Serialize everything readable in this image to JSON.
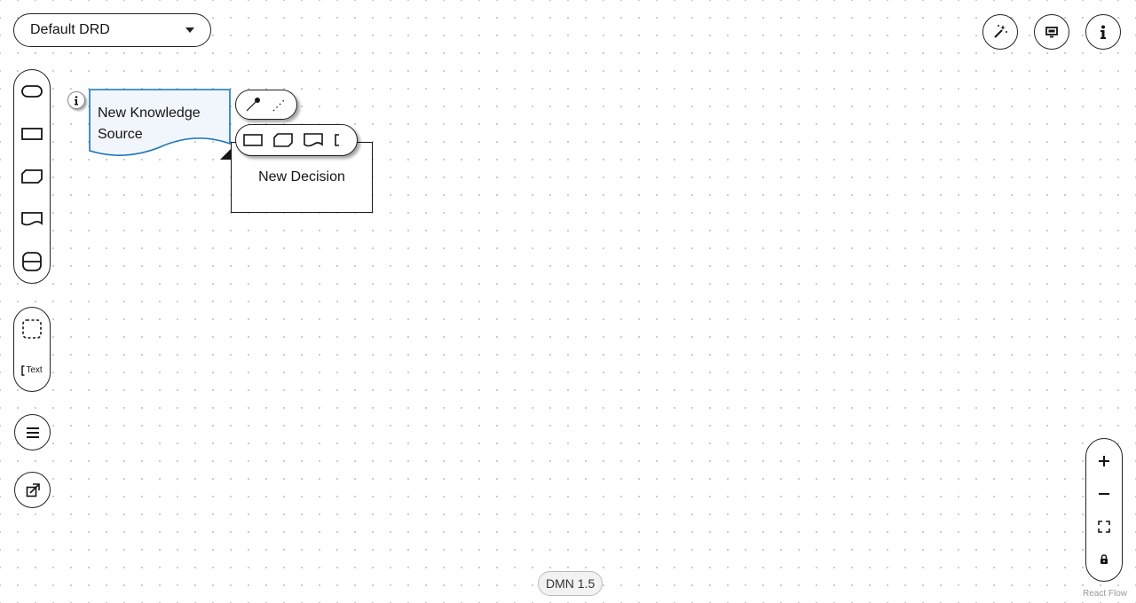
{
  "drd_selector": {
    "value": "Default DRD"
  },
  "top_actions": [
    {
      "name": "auto-layout-button",
      "icon": "magic-wand-icon"
    },
    {
      "name": "overlays-button",
      "icon": "monitor-icon"
    },
    {
      "name": "properties-button",
      "icon": "info-icon"
    }
  ],
  "palette": {
    "nodes": [
      "input-data",
      "decision",
      "business-knowledge-model",
      "knowledge-source",
      "decision-service"
    ],
    "annotations": [
      "group",
      "text-annotation"
    ],
    "text_annotation_label": "Text",
    "extra": [
      "outline-menu",
      "external-models"
    ]
  },
  "nodes": {
    "knowledge_source": {
      "label": "New Knowledge Source"
    },
    "decision": {
      "label": "New Decision"
    }
  },
  "zoom_controls": [
    "zoom-in",
    "zoom-out",
    "fit-view",
    "lock"
  ],
  "footer": {
    "dmn_version": "DMN 1.5",
    "attribution": "React Flow"
  },
  "colors": {
    "selection": "#1a73b8",
    "knowledge_source_fill": "#f0f6fb",
    "border": "#151515"
  }
}
